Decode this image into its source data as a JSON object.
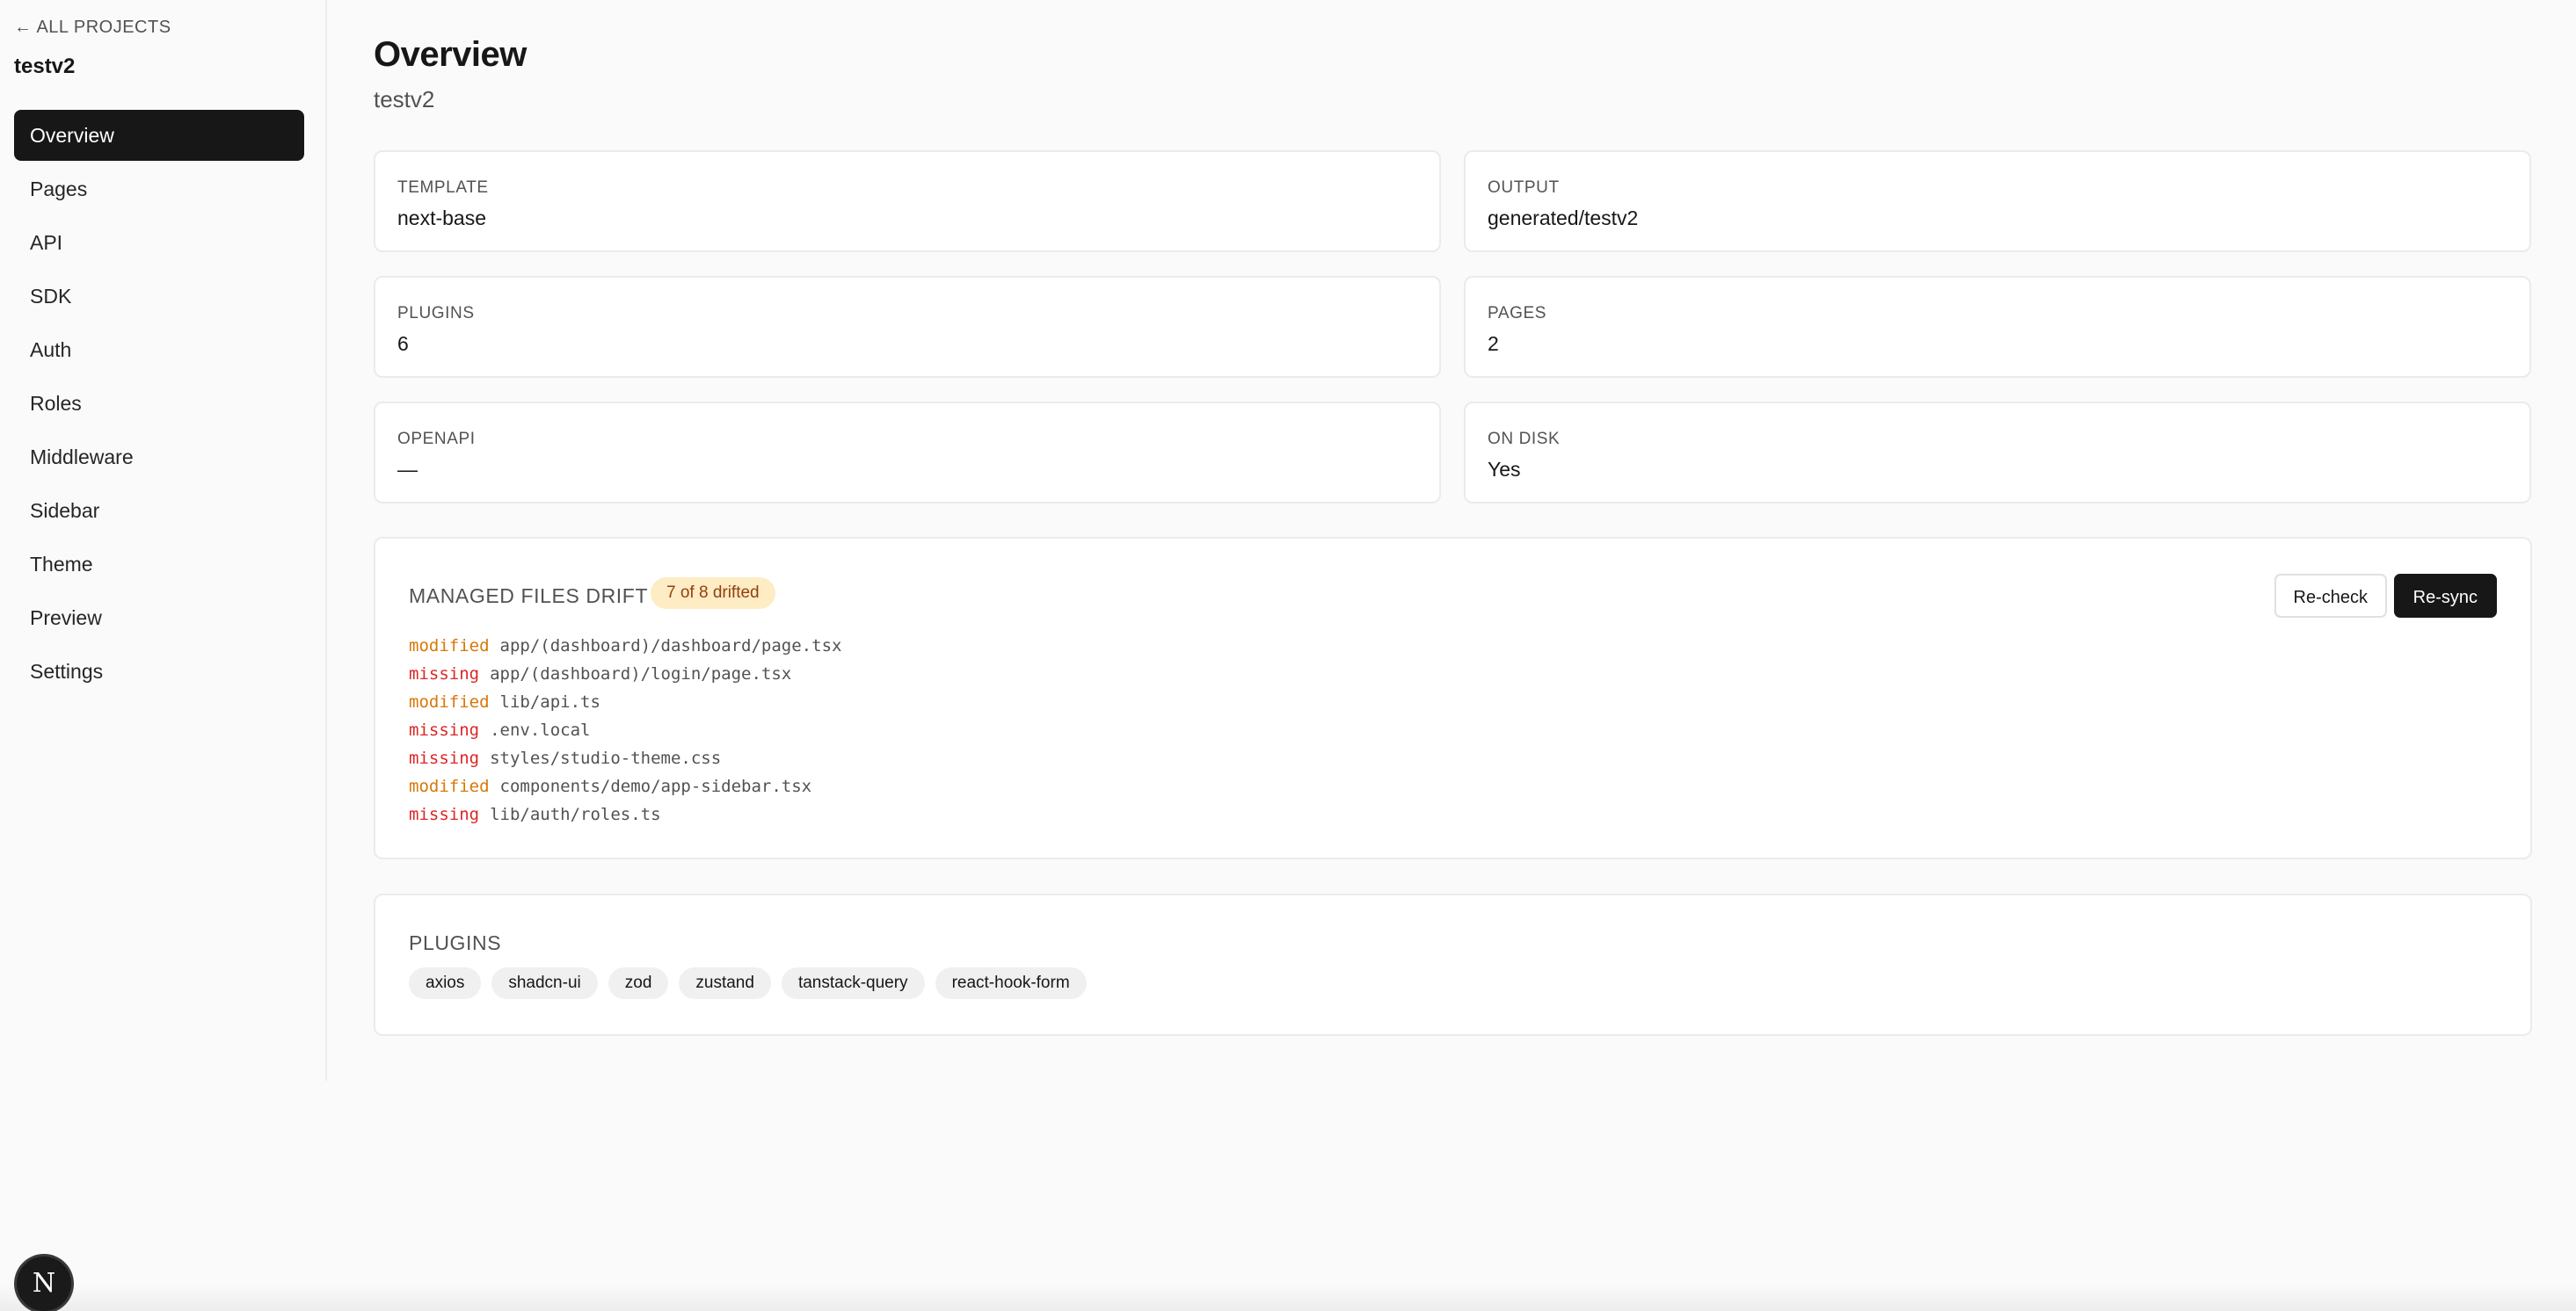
{
  "sidebar": {
    "back_label": "← ALL PROJECTS",
    "project_name": "testv2",
    "items": [
      {
        "label": "Overview"
      },
      {
        "label": "Pages"
      },
      {
        "label": "API"
      },
      {
        "label": "SDK"
      },
      {
        "label": "Auth"
      },
      {
        "label": "Roles"
      },
      {
        "label": "Middleware"
      },
      {
        "label": "Sidebar"
      },
      {
        "label": "Theme"
      },
      {
        "label": "Preview"
      },
      {
        "label": "Settings"
      }
    ]
  },
  "header": {
    "title": "Overview",
    "subtitle": "testv2"
  },
  "cards": [
    {
      "label": "TEMPLATE",
      "value": "next-base"
    },
    {
      "label": "OUTPUT",
      "value": "generated/testv2"
    },
    {
      "label": "PLUGINS",
      "value": "6"
    },
    {
      "label": "PAGES",
      "value": "2"
    },
    {
      "label": "OPENAPI",
      "value": "—"
    },
    {
      "label": "ON DISK",
      "value": "Yes"
    }
  ],
  "drift": {
    "title": "MANAGED FILES DRIFT",
    "badge": "7 of 8 drifted",
    "recheck_label": "Re-check",
    "resync_label": "Re-sync",
    "rows": [
      {
        "status": "modified",
        "path": "app/(dashboard)/dashboard/page.tsx"
      },
      {
        "status": "missing",
        "path": "app/(dashboard)/login/page.tsx"
      },
      {
        "status": "modified",
        "path": "lib/api.ts"
      },
      {
        "status": "missing",
        "path": ".env.local"
      },
      {
        "status": "missing",
        "path": "styles/studio-theme.css"
      },
      {
        "status": "modified",
        "path": "components/demo/app-sidebar.tsx"
      },
      {
        "status": "missing",
        "path": "lib/auth/roles.ts"
      }
    ]
  },
  "plugins": {
    "title": "PLUGINS",
    "items": [
      "axios",
      "shadcn-ui",
      "zod",
      "zustand",
      "tanstack-query",
      "react-hook-form"
    ]
  },
  "devtools": {
    "badge_letter": "N"
  },
  "colors": {
    "accent": "#171717",
    "modified": "#d97706",
    "missing": "#dc2626",
    "badge_bg": "#fdecc4"
  }
}
